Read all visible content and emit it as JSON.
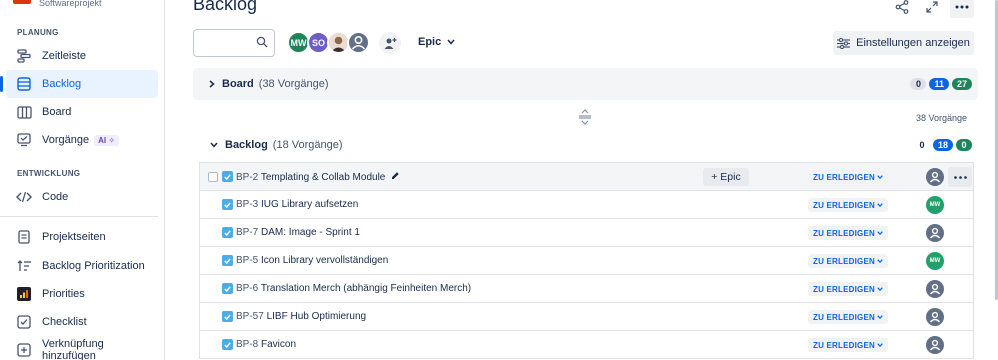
{
  "project": {
    "subtitle": "Softwareprojekt"
  },
  "sidebar": {
    "planning_title": "PLANUNG",
    "development_title": "ENTWICKLUNG",
    "items": [
      {
        "label": "Zeitleiste",
        "icon": "timeline-icon"
      },
      {
        "label": "Backlog",
        "icon": "backlog-icon",
        "active": true
      },
      {
        "label": "Board",
        "icon": "board-icon"
      },
      {
        "label": "Vorgänge",
        "icon": "issues-icon",
        "badge": "AI ✧"
      },
      {
        "label": "Code",
        "icon": "code-icon"
      },
      {
        "label": "Projektseiten",
        "icon": "pages-icon"
      },
      {
        "label": "Backlog Prioritization",
        "icon": "prioritization-icon"
      },
      {
        "label": "Priorities",
        "icon": "priorities-icon"
      },
      {
        "label": "Checklist",
        "icon": "checklist-icon"
      },
      {
        "label": "Verknüpfung hinzufügen",
        "icon": "link-icon"
      }
    ]
  },
  "header": {
    "title": "Backlog"
  },
  "toolbar": {
    "avatars": [
      {
        "initials": "MW",
        "color": "#1f845a"
      },
      {
        "initials": "SO",
        "color": "#6e5dc6"
      }
    ],
    "epic_filter": "Epic",
    "settings_label": "Einstellungen anzeigen"
  },
  "board": {
    "title": "Board",
    "count": "(38 Vorgänge)",
    "pills": [
      "0",
      "11",
      "27"
    ]
  },
  "total_count": "38 Vorgänge",
  "backlog": {
    "title": "Backlog",
    "count": "(18 Vorgänge)",
    "pills": [
      "0",
      "18",
      "0"
    ]
  },
  "add_epic_label": "+ Epic",
  "issues": [
    {
      "key": "BP-2",
      "summary": "Templating & Collab Module",
      "status": "ZU ERLEDIGEN",
      "assignee": "none"
    },
    {
      "key": "BP-3",
      "summary": "IUG Library aufsetzen",
      "status": "ZU ERLEDIGEN",
      "assignee": "MW"
    },
    {
      "key": "BP-7",
      "summary": "DAM: Image - Sprint 1",
      "status": "ZU ERLEDIGEN",
      "assignee": "none"
    },
    {
      "key": "BP-5",
      "summary": "Icon Library vervollständigen",
      "status": "ZU ERLEDIGEN",
      "assignee": "MW"
    },
    {
      "key": "BP-6",
      "summary": "Translation Merch (abhängig Feinheiten Merch)",
      "status": "ZU ERLEDIGEN",
      "assignee": "none"
    },
    {
      "key": "BP-57",
      "summary": "LIBF Hub Optimierung",
      "status": "ZU ERLEDIGEN",
      "assignee": "none"
    },
    {
      "key": "BP-8",
      "summary": "Favicon",
      "status": "ZU ERLEDIGEN",
      "assignee": "none"
    }
  ],
  "colors": {
    "accent": "#0c66e4",
    "task": "#4bade8",
    "done_green": "#1f845a"
  }
}
